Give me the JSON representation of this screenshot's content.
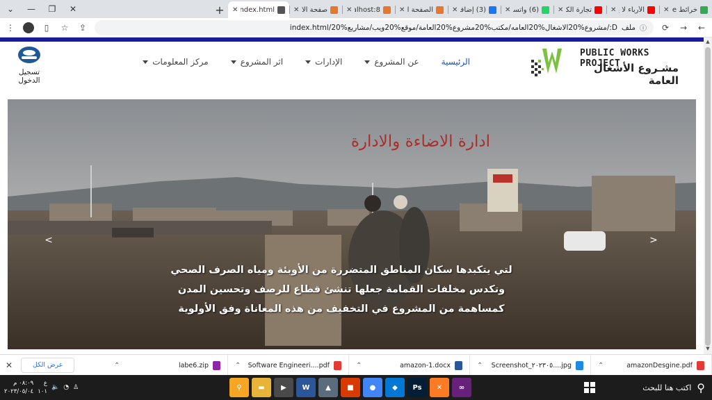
{
  "browser": {
    "tabs": [
      {
        "label": "خرائط Google",
        "color": "#34a853",
        "active": false
      },
      {
        "label": "الأرباء لا يـ",
        "color": "#ff0000",
        "active": false
      },
      {
        "label": "تجارة الكترو",
        "color": "#ff0000",
        "active": false
      },
      {
        "label": "(6) واتساب",
        "color": "#25d366",
        "active": false
      },
      {
        "label": "(3) إضافة",
        "color": "#1877f2",
        "active": false
      },
      {
        "label": "الصفحة الر",
        "color": "#e8772e",
        "active": false
      },
      {
        "label": "localhost:8",
        "color": "#e8772e",
        "active": false
      },
      {
        "label": "صفحة الاقـ",
        "color": "#e8772e",
        "active": false
      },
      {
        "label": "index.html",
        "color": "#555555",
        "active": true
      }
    ],
    "new_tab_symbol": "+",
    "url": "D:/مشروع%20الاشغال%20العامه/مكتب%20مشروع%20العامة/موقع%20ويب/مشاريع%20/index.html",
    "url_prefix": "ملف"
  },
  "site": {
    "logo": {
      "text_en": "PUBLIC WORKS PROJECT",
      "text_ar": "مشـروع الأشغال العامة"
    },
    "nav": [
      {
        "label": "الرئيسية",
        "dropdown": false,
        "active": true
      },
      {
        "label": "عن المشروع",
        "dropdown": true,
        "active": false
      },
      {
        "label": "الإدارات",
        "dropdown": true,
        "active": false
      },
      {
        "label": "اثر المشروع",
        "dropdown": true,
        "active": false
      },
      {
        "label": "مركز المعلومات",
        "dropdown": true,
        "active": false
      }
    ],
    "login_label": "تسجيل الدخول",
    "hero": {
      "title": "ادارة الاضاءة والادارة",
      "caption_lines": [
        "لتي يتكبدها سكان المناطق المتضررة من الأوبئة ومياه الصرف الصحي",
        "وتكدس مخلفات القمامة جعلها تنشئ قطاع للرصف وتحسين المدن",
        "كمساهمة من المشروع في التخفيف من هذه المعاناة وفق الأولوية"
      ],
      "prev_symbol": "<",
      "next_symbol": ">"
    }
  },
  "downloads": {
    "show_all_label": "عرض الكل",
    "items": [
      {
        "name": "amazonDesgine.pdf",
        "color": "#e53935"
      },
      {
        "name": "Screenshot_٢٠٢٣٠٥....jpg",
        "color": "#1e88e5"
      },
      {
        "name": "amazon-1.docx",
        "color": "#2b579a"
      },
      {
        "name": "Software Engineeri....pdf",
        "color": "#e53935"
      },
      {
        "name": "labe6.zip",
        "color": "#8e24aa"
      }
    ]
  },
  "taskbar": {
    "search_label": "اكتب هنا للبحث",
    "clock_time": "٠٨:٠٩ م",
    "clock_date": "٢٠٢٣/٠٥/٠٤",
    "lang_top": "ع",
    "lang_bottom": "١٠١",
    "apps": [
      {
        "name": "search-app",
        "color": "#f6a623",
        "glyph": "⚲"
      },
      {
        "name": "file-explorer",
        "color": "#e8b339",
        "glyph": "▬"
      },
      {
        "name": "video-app",
        "color": "#4a4a4a",
        "glyph": "▶"
      },
      {
        "name": "word",
        "color": "#2b579a",
        "glyph": "W"
      },
      {
        "name": "photos",
        "color": "#5a6c7d",
        "glyph": "▲"
      },
      {
        "name": "office-app",
        "color": "#d83b01",
        "glyph": "■"
      },
      {
        "name": "chrome",
        "color": "#4285f4",
        "glyph": "●"
      },
      {
        "name": "vscode",
        "color": "#0078d4",
        "glyph": "◆"
      },
      {
        "name": "photoshop",
        "color": "#001e36",
        "glyph": "Ps"
      },
      {
        "name": "xampp",
        "color": "#fb7a24",
        "glyph": "✕"
      },
      {
        "name": "visual-studio",
        "color": "#68217a",
        "glyph": "∞"
      }
    ]
  }
}
